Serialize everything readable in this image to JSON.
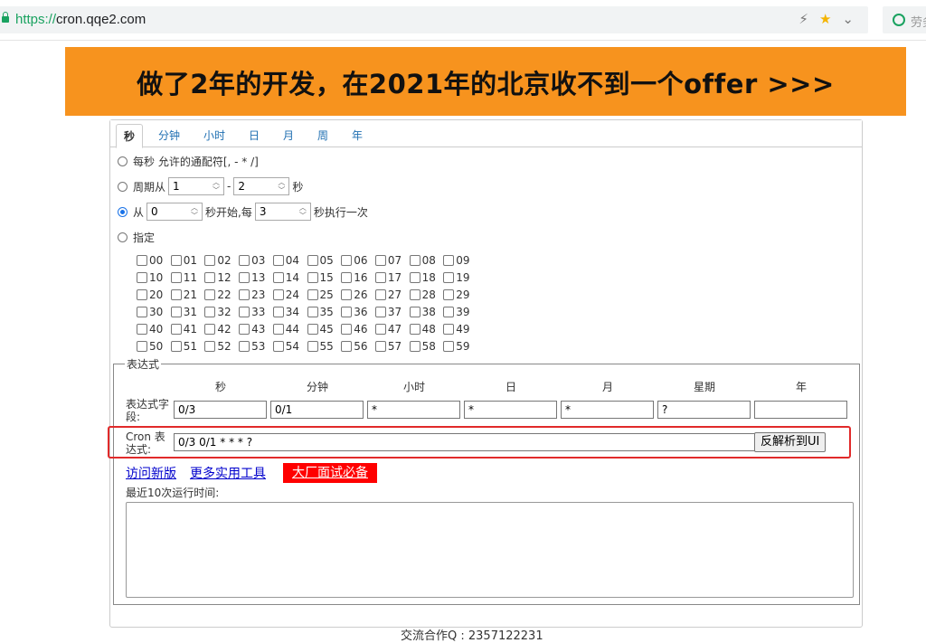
{
  "browser": {
    "url_scheme": "https://",
    "url_host": "cron.qqe2.com",
    "extension_text": "劳务"
  },
  "banner": {
    "text": "做了2年的开发，在2021年的北京收不到一个offer  >>>"
  },
  "tabs": [
    "秒",
    "分钟",
    "小时",
    "日",
    "月",
    "周",
    "年"
  ],
  "options": {
    "every": {
      "label": "每秒 允许的通配符[, - * /]"
    },
    "cycle": {
      "prefix": "周期从",
      "from": "1",
      "dash": "-",
      "to": "2",
      "suffix": "秒"
    },
    "from": {
      "prefix": "从",
      "start": "0",
      "mid": "秒开始,每",
      "step": "3",
      "suffix": "秒执行一次",
      "selected": true
    },
    "specify": {
      "label": "指定"
    }
  },
  "seconds": [
    "00",
    "01",
    "02",
    "03",
    "04",
    "05",
    "06",
    "07",
    "08",
    "09",
    "10",
    "11",
    "12",
    "13",
    "14",
    "15",
    "16",
    "17",
    "18",
    "19",
    "20",
    "21",
    "22",
    "23",
    "24",
    "25",
    "26",
    "27",
    "28",
    "29",
    "30",
    "31",
    "32",
    "33",
    "34",
    "35",
    "36",
    "37",
    "38",
    "39",
    "40",
    "41",
    "42",
    "43",
    "44",
    "45",
    "46",
    "47",
    "48",
    "49",
    "50",
    "51",
    "52",
    "53",
    "54",
    "55",
    "56",
    "57",
    "58",
    "59"
  ],
  "expression": {
    "legend": "表达式",
    "columns": [
      "秒",
      "分钟",
      "小时",
      "日",
      "月",
      "星期",
      "年"
    ],
    "field_label": "表达式字段:",
    "fields": [
      "0/3",
      "0/1",
      "*",
      "*",
      "*",
      "?",
      ""
    ],
    "cron_label": "Cron 表达式:",
    "cron_value": "0/3 0/1 * * * ?",
    "parse_button": "反解析到UI"
  },
  "links": {
    "new_version": "访问新版",
    "more_tools": "更多实用工具",
    "interview": "大厂面试必备"
  },
  "recent_runs_label": "最近10次运行时间:",
  "footer_text": "交流合作Q : 2357122231",
  "colors": {
    "banner": "#f7931e",
    "highlight": "#e12a2a",
    "link": "#0000cc",
    "interview_bg": "#ff0000"
  }
}
